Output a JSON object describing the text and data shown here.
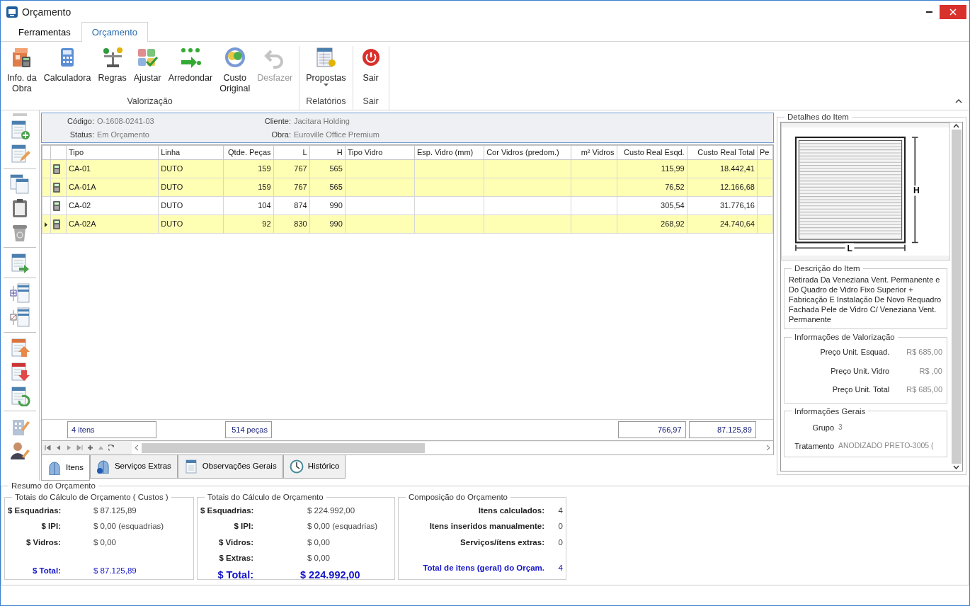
{
  "window": {
    "title": "Orçamento"
  },
  "ribbon_tabs": [
    {
      "label": "Ferramentas",
      "selected": false
    },
    {
      "label": "Orçamento",
      "selected": true
    }
  ],
  "ribbon_groups": [
    {
      "label": "Valorização",
      "buttons": [
        {
          "lines": [
            "Info. da",
            "Obra"
          ],
          "disabled": false
        },
        {
          "lines": [
            "Calculadora"
          ],
          "disabled": false
        },
        {
          "lines": [
            "Regras"
          ],
          "disabled": false
        },
        {
          "lines": [
            "Ajustar"
          ],
          "disabled": false
        },
        {
          "lines": [
            "Arredondar"
          ],
          "disabled": false
        },
        {
          "lines": [
            "Custo",
            "Original"
          ],
          "disabled": false
        },
        {
          "lines": [
            "Desfazer"
          ],
          "disabled": true
        }
      ]
    },
    {
      "label": "Relatórios",
      "buttons": [
        {
          "lines": [
            "Propostas"
          ],
          "disabled": false,
          "dropdown": true
        }
      ]
    },
    {
      "label": "Sair",
      "buttons": [
        {
          "lines": [
            "Sair"
          ],
          "disabled": false
        }
      ]
    }
  ],
  "header_info": [
    {
      "label": "Código:",
      "value": "O-1608-0241-03"
    },
    {
      "label": "Cliente:",
      "value": "Jacitara Holding"
    },
    {
      "label": "Status:",
      "value": "Em Orçamento"
    },
    {
      "label": "Obra:",
      "value": "Euroville Office Premium"
    }
  ],
  "table": {
    "columns": [
      {
        "label": "Tipo",
        "kind": "text",
        "total": "4 itens"
      },
      {
        "label": "Linha",
        "kind": "text"
      },
      {
        "label": "Qtde. Peças",
        "kind": "number",
        "total": "514 peças"
      },
      {
        "label": "L",
        "kind": "number"
      },
      {
        "label": "H",
        "kind": "number"
      },
      {
        "label": "Tipo Vidro",
        "kind": "text"
      },
      {
        "label": "Esp. Vidro (mm)",
        "kind": "text"
      },
      {
        "label": "Cor Vidros (predom.)",
        "kind": "text"
      },
      {
        "label": "m² Vidros",
        "kind": "number"
      },
      {
        "label": "Custo Real Esqd.",
        "kind": "number",
        "total": "766,97"
      },
      {
        "label": "Custo Real Total",
        "kind": "number",
        "total": "87.125,89"
      },
      {
        "label": "Pe",
        "kind": "text"
      }
    ],
    "rows": [
      {
        "highlighted": true,
        "current": false,
        "cells": [
          "CA-01",
          "DUTO",
          "159",
          "767",
          "565",
          null,
          null,
          null,
          null,
          "115,99",
          "18.442,41",
          null
        ]
      },
      {
        "highlighted": true,
        "current": false,
        "cells": [
          "CA-01A",
          "DUTO",
          "159",
          "767",
          "565",
          null,
          null,
          null,
          null,
          "76,52",
          "12.166,68",
          null
        ]
      },
      {
        "highlighted": false,
        "current": false,
        "cells": [
          "CA-02",
          "DUTO",
          "104",
          "874",
          "990",
          null,
          null,
          null,
          null,
          "305,54",
          "31.776,16",
          null
        ]
      },
      {
        "highlighted": true,
        "current": true,
        "cells": [
          "CA-02A",
          "DUTO",
          "92",
          "830",
          "990",
          null,
          null,
          null,
          null,
          "268,92",
          "24.740,64",
          null
        ]
      }
    ]
  },
  "bottom_tabs": [
    {
      "label": "Itens",
      "selected": true
    },
    {
      "label": "Serviços Extras",
      "selected": false
    },
    {
      "label": "Observações Gerais",
      "selected": false
    },
    {
      "label": "Histórico",
      "selected": false
    }
  ],
  "details": {
    "title": "Detalhes do Item",
    "drawing": {
      "width_label": "L",
      "height_label": "H"
    },
    "description": {
      "title": "Descrição do Item",
      "text": "Retirada Da Veneziana Vent. Permanente e Do Quadro de Vidro Fixo Superior + Fabricação E Instalação De Novo Requadro Fachada Pele de Vidro C/ Veneziana Vent. Permanente"
    },
    "valuation": {
      "title": "Informações de Valorização",
      "rows": [
        {
          "label": "Preço Unit. Esquad.",
          "value": "R$ 685,00"
        },
        {
          "label": "Preço Unit. Vidro",
          "value": "R$ ,00"
        },
        {
          "label": "Preço Unit. Total",
          "value": "R$ 685,00"
        }
      ]
    },
    "general": {
      "title": "Informações Gerais",
      "rows": [
        {
          "label": "Grupo",
          "value": "3"
        },
        {
          "label": "Tratamento",
          "value": "ANODIZADO PRETO-3005 ("
        }
      ]
    }
  },
  "summary": {
    "title": "Resumo do Orçamento",
    "groups": [
      {
        "title": "Totais do Cálculo de Orçamento ( Custos )",
        "kind": "values",
        "rows": [
          {
            "kind": "row",
            "label": "$ Esquadrias:",
            "value": "$ 87.125,89"
          },
          {
            "kind": "row",
            "label": "$ IPI:",
            "value": "$ 0,00",
            "note": "(esquadrias)"
          },
          {
            "kind": "row",
            "label": "$ Vidros:",
            "value": "$ 0,00"
          },
          {
            "kind": "total",
            "label": "$ Total:",
            "value": "$ 87.125,89"
          }
        ]
      },
      {
        "title": "Totais do Cálculo de Orçamento",
        "kind": "values",
        "rows": [
          {
            "kind": "row",
            "label": "$ Esquadrias:",
            "value": "$ 224.992,00"
          },
          {
            "kind": "row",
            "label": "$ IPI:",
            "value": "$ 0,00",
            "note": "(esquadrias)"
          },
          {
            "kind": "row",
            "label": "$ Vidros:",
            "value": "$ 0,00"
          },
          {
            "kind": "row",
            "label": "$ Extras:",
            "value": "$ 0,00"
          },
          {
            "kind": "grand_total",
            "label": "$ Total:",
            "value": "$ 224.992,00"
          }
        ]
      },
      {
        "title": "Composição do Orçamento",
        "kind": "counts",
        "rows": [
          {
            "kind": "row",
            "label": "Itens calculados:",
            "value": "4"
          },
          {
            "kind": "row",
            "label": "Itens inseridos manualmente:",
            "value": "0"
          },
          {
            "kind": "row",
            "label": "Serviços/ítens extras:",
            "value": "0"
          },
          {
            "kind": "total",
            "label": "Total de itens (geral) do Orçam.",
            "value": "4"
          }
        ]
      }
    ]
  }
}
